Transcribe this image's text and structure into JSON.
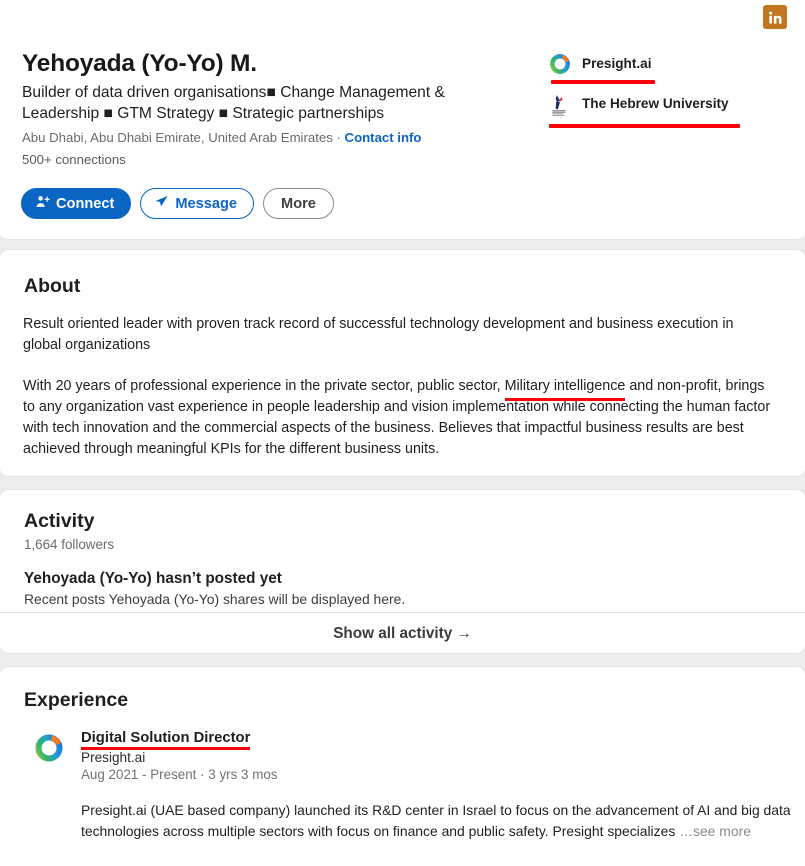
{
  "colors": {
    "accent_blue": "#0a66c2",
    "highlight_red": "#fb0007",
    "badge_orange": "#c1761f",
    "page_bg": "#ededed",
    "card_bg": "#ffffff"
  },
  "badge": {
    "icon": "linkedin-icon",
    "label": "in"
  },
  "profile": {
    "name": "Yehoyada (Yo-Yo) M.",
    "headline": "Builder of data driven organisations■ Change Management & Leadership ■ GTM Strategy ■ Strategic partnerships",
    "location": "Abu Dhabi, Abu Dhabi Emirate, United Arab Emirates",
    "separator": " · ",
    "contact_info": "Contact info",
    "connections": "500+ connections",
    "avatar_icon": "profile-photo"
  },
  "actions": {
    "connect": "Connect",
    "message": "Message",
    "more": "More",
    "connect_icon": "person-add-icon",
    "message_icon": "send-icon"
  },
  "organizations": [
    {
      "name": "Presight.ai",
      "logo_icon": "presight-ring-logo",
      "highlighted": true
    },
    {
      "name": "The Hebrew University",
      "logo_icon": "hebrew-university-logo",
      "highlighted": true
    }
  ],
  "about": {
    "title": "About",
    "paragraph1": "Result oriented leader with proven track record of successful technology development and business execution in global organizations",
    "p2_before": "With 20 years of professional experience in the private sector, public sector, ",
    "p2_highlight": "Military intelligence",
    "p2_after": " and non-profit, brings to any organization vast experience in people leadership and vision implementation while connecting the human factor with tech innovation and the commercial aspects of the business. Believes that impactful business results are best achieved through meaningful KPIs for the different business units."
  },
  "activity": {
    "title": "Activity",
    "followers": "1,664 followers",
    "empty_heading": "Yehoyada (Yo-Yo) hasn’t posted yet",
    "empty_sub": "Recent posts Yehoyada (Yo-Yo) shares will be displayed here.",
    "show_all": "Show all activity →"
  },
  "experience": {
    "title": "Experience",
    "items": [
      {
        "role": "Digital Solution Director",
        "company": "Presight.ai",
        "dates": "Aug 2021 - Present · 3 yrs 3 mos",
        "description": "Presight.ai (UAE based company) launched its R&D center in Israel to focus on the advancement of AI and big data technologies across multiple sectors with focus on finance and public safety. Presight specializes",
        "see_more": "…see more",
        "logo_icon": "presight-ring-logo",
        "highlighted": true
      }
    ]
  }
}
